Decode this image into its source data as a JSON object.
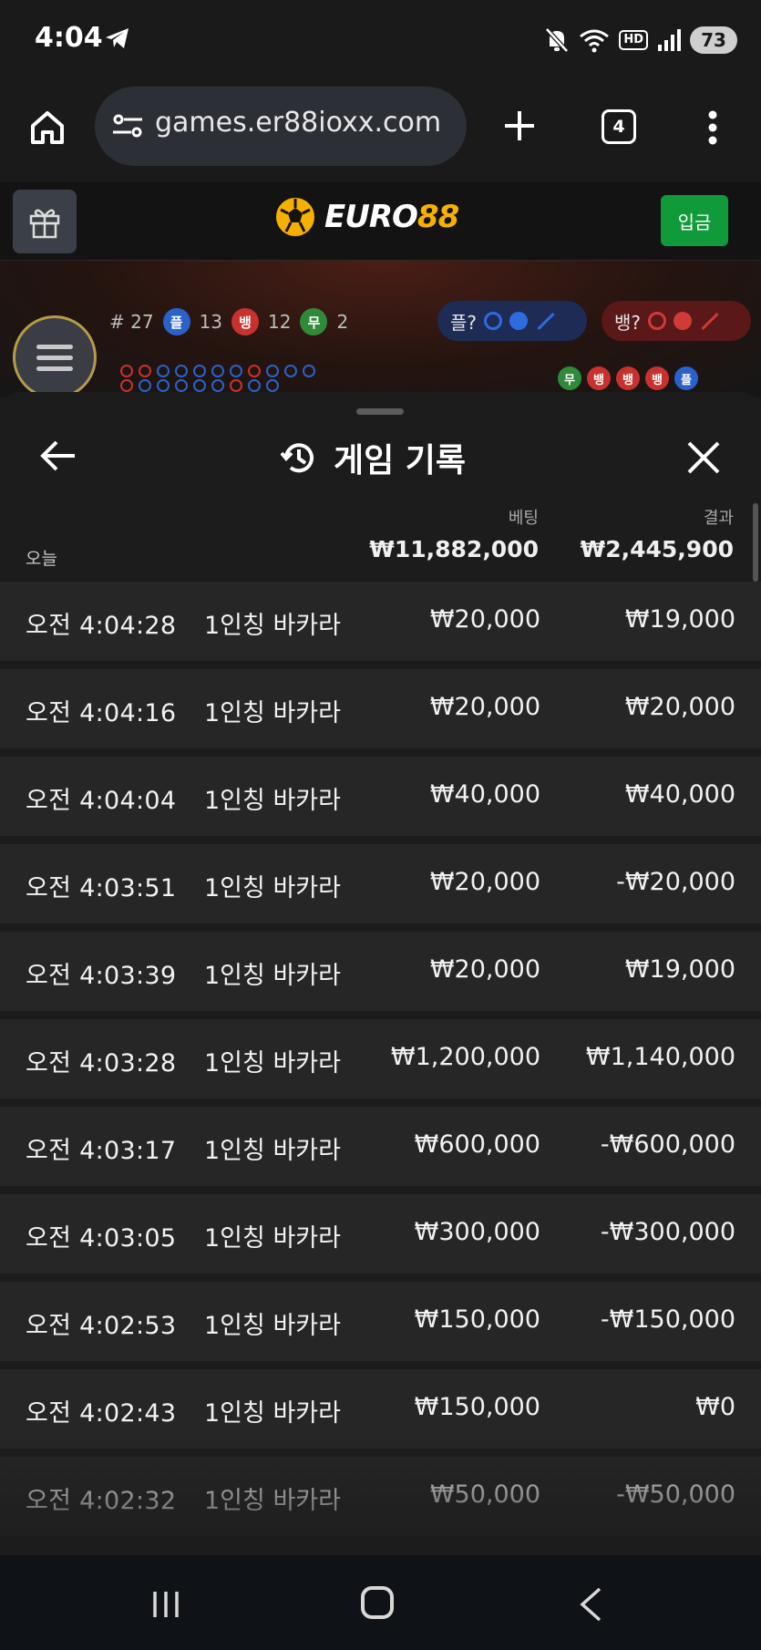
{
  "status_bar": {
    "time": "4:04",
    "hd": "HD",
    "battery": "73",
    "icons": [
      "telegram-icon",
      "mute-icon",
      "wifi-icon",
      "hd-icon",
      "signal-icon",
      "battery-icon"
    ]
  },
  "browser": {
    "url": "games.er88ioxx.com",
    "tab_count": "4",
    "icons": [
      "home-icon",
      "site-settings-icon",
      "new-tab-icon",
      "tabs-icon",
      "more-icon"
    ]
  },
  "site": {
    "logo_text_1": "EURO",
    "logo_text_2": "88",
    "deposit_label": "입금",
    "icons": [
      "gift-icon",
      "soccer-ball-icon"
    ]
  },
  "game": {
    "round": "# 27",
    "player_badge": "플",
    "player_count": "13",
    "banker_badge": "뱅",
    "banker_count": "12",
    "tie_badge": "무",
    "tie_count": "2",
    "ask_player": "플?",
    "ask_banker": "뱅?",
    "last_results": [
      "무",
      "뱅",
      "뱅",
      "뱅",
      "플"
    ],
    "colors": {
      "player": "#2a62c9",
      "banker": "#c7322f",
      "tie": "#2f8a3a"
    }
  },
  "history": {
    "title": "게임 기록",
    "col_bet": "베팅",
    "col_result": "결과",
    "today_label": "오늘",
    "total_bet": "₩11,882,000",
    "total_result": "₩2,445,900",
    "rows": [
      {
        "time": "오전 4:04:28",
        "game": "1인칭 바카라",
        "bet": "₩20,000",
        "result": "₩19,000"
      },
      {
        "time": "오전 4:04:16",
        "game": "1인칭 바카라",
        "bet": "₩20,000",
        "result": "₩20,000"
      },
      {
        "time": "오전 4:04:04",
        "game": "1인칭 바카라",
        "bet": "₩40,000",
        "result": "₩40,000"
      },
      {
        "time": "오전 4:03:51",
        "game": "1인칭 바카라",
        "bet": "₩20,000",
        "result": "-₩20,000"
      },
      {
        "time": "오전 4:03:39",
        "game": "1인칭 바카라",
        "bet": "₩20,000",
        "result": "₩19,000"
      },
      {
        "time": "오전 4:03:28",
        "game": "1인칭 바카라",
        "bet": "₩1,200,000",
        "result": "₩1,140,000"
      },
      {
        "time": "오전 4:03:17",
        "game": "1인칭 바카라",
        "bet": "₩600,000",
        "result": "-₩600,000"
      },
      {
        "time": "오전 4:03:05",
        "game": "1인칭 바카라",
        "bet": "₩300,000",
        "result": "-₩300,000"
      },
      {
        "time": "오전 4:02:53",
        "game": "1인칭 바카라",
        "bet": "₩150,000",
        "result": "-₩150,000"
      },
      {
        "time": "오전 4:02:43",
        "game": "1인칭 바카라",
        "bet": "₩150,000",
        "result": "₩0"
      },
      {
        "time": "오전 4:02:32",
        "game": "1인칭 바카라",
        "bet": "₩50,000",
        "result": "-₩50,000"
      }
    ],
    "icons": [
      "back-arrow-icon",
      "history-icon",
      "close-icon"
    ]
  },
  "nav": {
    "icons": [
      "recent-apps-icon",
      "home-button-icon",
      "back-icon"
    ]
  }
}
